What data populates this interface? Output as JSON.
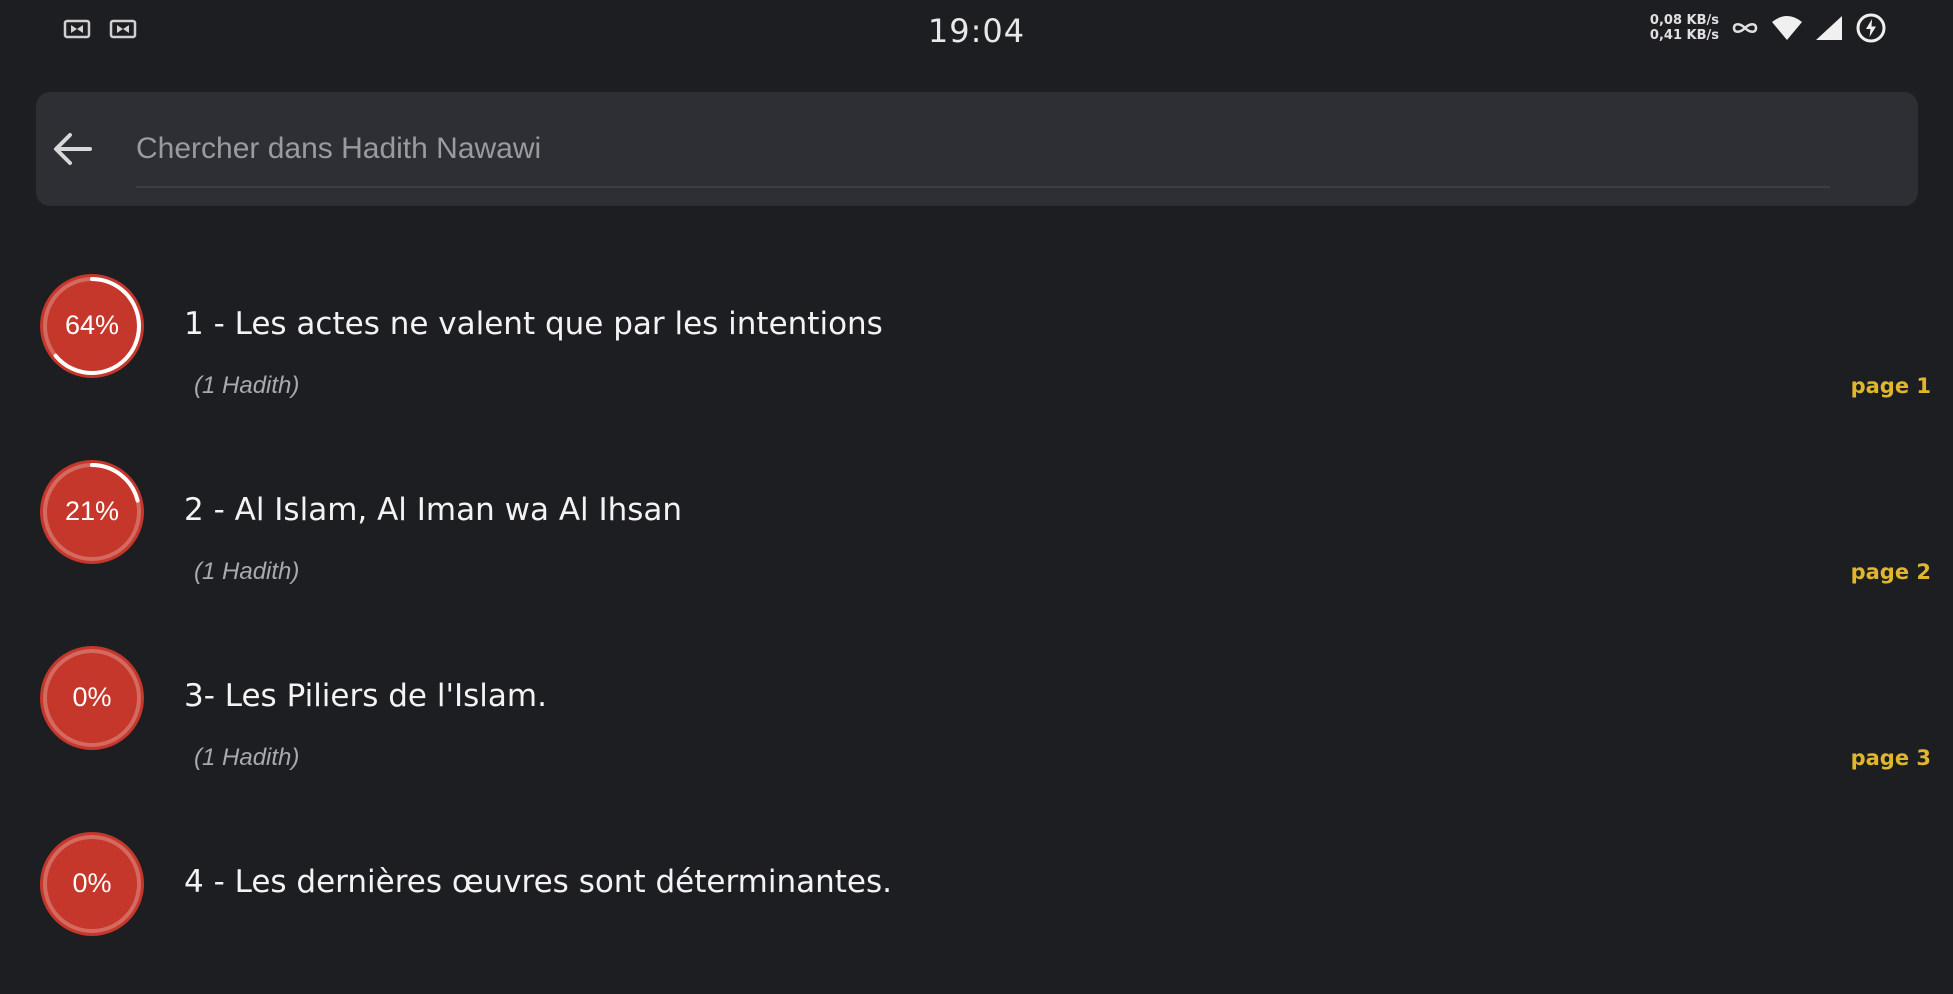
{
  "status_bar": {
    "time": "19:04",
    "net_speed_down": "0,08 KB/s",
    "net_speed_up": "0,41 KB/s",
    "left_icons": [
      "cast-icon",
      "cast-icon"
    ],
    "right_icons": [
      "infinity-icon",
      "wifi-icon",
      "signal-icon",
      "battery-icon"
    ]
  },
  "search": {
    "placeholder": "Chercher dans Hadith Nawawi",
    "value": ""
  },
  "colors": {
    "background": "#1d1e22",
    "search_bg": "#2e2f34",
    "progress_red": "#c6372b",
    "page_label": "#e0b62d"
  },
  "chapters": [
    {
      "progress_label": "64%",
      "progress": 0.64,
      "title": "1 - Les actes ne valent que par les intentions",
      "count": "(1 Hadith)",
      "page": "page 1"
    },
    {
      "progress_label": "21%",
      "progress": 0.21,
      "title": "2 - Al Islam, Al Iman wa Al Ihsan",
      "count": "(1 Hadith)",
      "page": "page 2"
    },
    {
      "progress_label": "0%",
      "progress": 0.0,
      "title": "3- Les Piliers de l'Islam.",
      "count": "(1 Hadith)",
      "page": "page 3"
    },
    {
      "progress_label": "0%",
      "progress": 0.0,
      "title": "4 - Les dernières œuvres sont déterminantes.",
      "count": "",
      "page": ""
    }
  ]
}
